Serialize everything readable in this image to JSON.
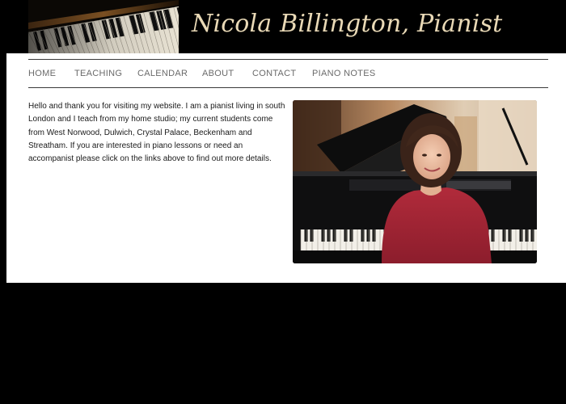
{
  "header": {
    "title": "Nicola Billington, Pianist",
    "banner_icon": "piano-keys-banner"
  },
  "nav": {
    "items": [
      {
        "label": "HOME",
        "active": true
      },
      {
        "label": "TEACHING",
        "active": false
      },
      {
        "label": "CALENDAR",
        "active": false
      },
      {
        "label": "ABOUT",
        "active": false
      },
      {
        "label": "CONTACT",
        "active": false
      },
      {
        "label": "PIANO NOTES",
        "active": false
      }
    ]
  },
  "main": {
    "intro": "Hello and thank you for visiting my website. I am a pianist living in south London and I teach from my home studio; my current students come from West Norwood, Dulwich, Crystal Palace, Beckenham and Streatham. If you are interested in piano lessons or need an accompanist please click on the links above to find out more details.",
    "photo_icon": "pianist-portrait-photo"
  },
  "colors": {
    "page_background": "#000000",
    "panel_background": "#ffffff",
    "title_color": "#e9d9b6",
    "nav_active": "#000000",
    "nav_inactive": "#6a6a6a"
  }
}
